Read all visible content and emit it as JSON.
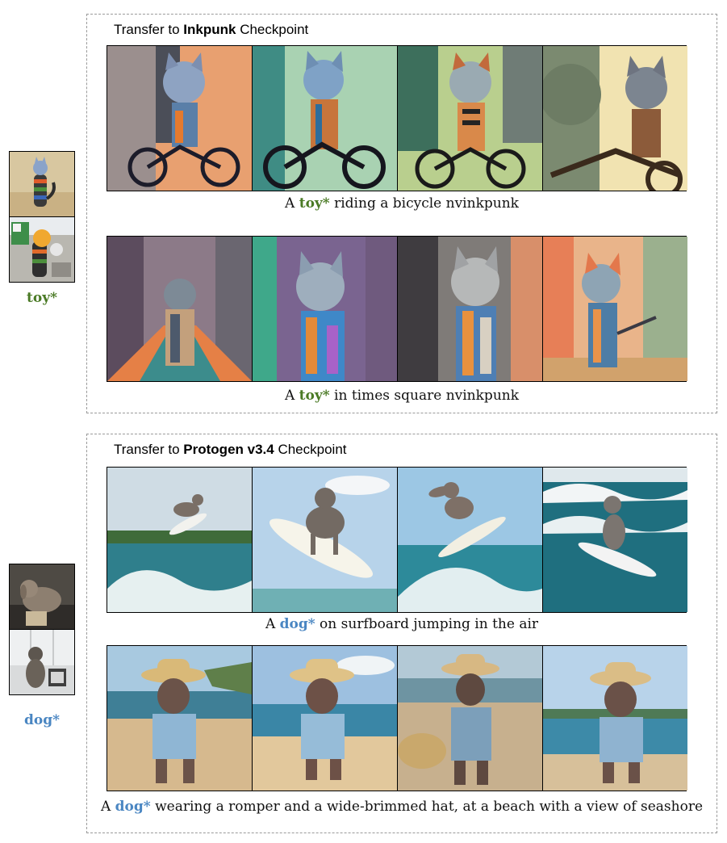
{
  "colors": {
    "toy_token": "#4a7a25",
    "dog_token": "#4a86c2",
    "panel_border": "#9a9a9a"
  },
  "sections": [
    {
      "token": "toy*",
      "title_prefix": "Transfer to ",
      "title_bold": "Inkpunk",
      "title_suffix": " Checkpoint",
      "rows": [
        {
          "caption_prefix": "A ",
          "caption_token": "toy*",
          "caption_suffix": " riding a bicycle nvinkpunk"
        },
        {
          "caption_prefix": "A ",
          "caption_token": "toy*",
          "caption_suffix": " in times square nvinkpunk"
        }
      ]
    },
    {
      "token": "dog*",
      "title_prefix": "Transfer to ",
      "title_bold": "Protogen v3.4",
      "title_suffix": " Checkpoint",
      "rows": [
        {
          "caption_prefix": "A ",
          "caption_token": "dog*",
          "caption_suffix": " on surfboard jumping in the air"
        },
        {
          "caption_prefix": "A ",
          "caption_token": "dog*",
          "caption_suffix": " wearing a romper and a wide-brimmed hat, at a beach with a view of seashore"
        }
      ]
    }
  ]
}
